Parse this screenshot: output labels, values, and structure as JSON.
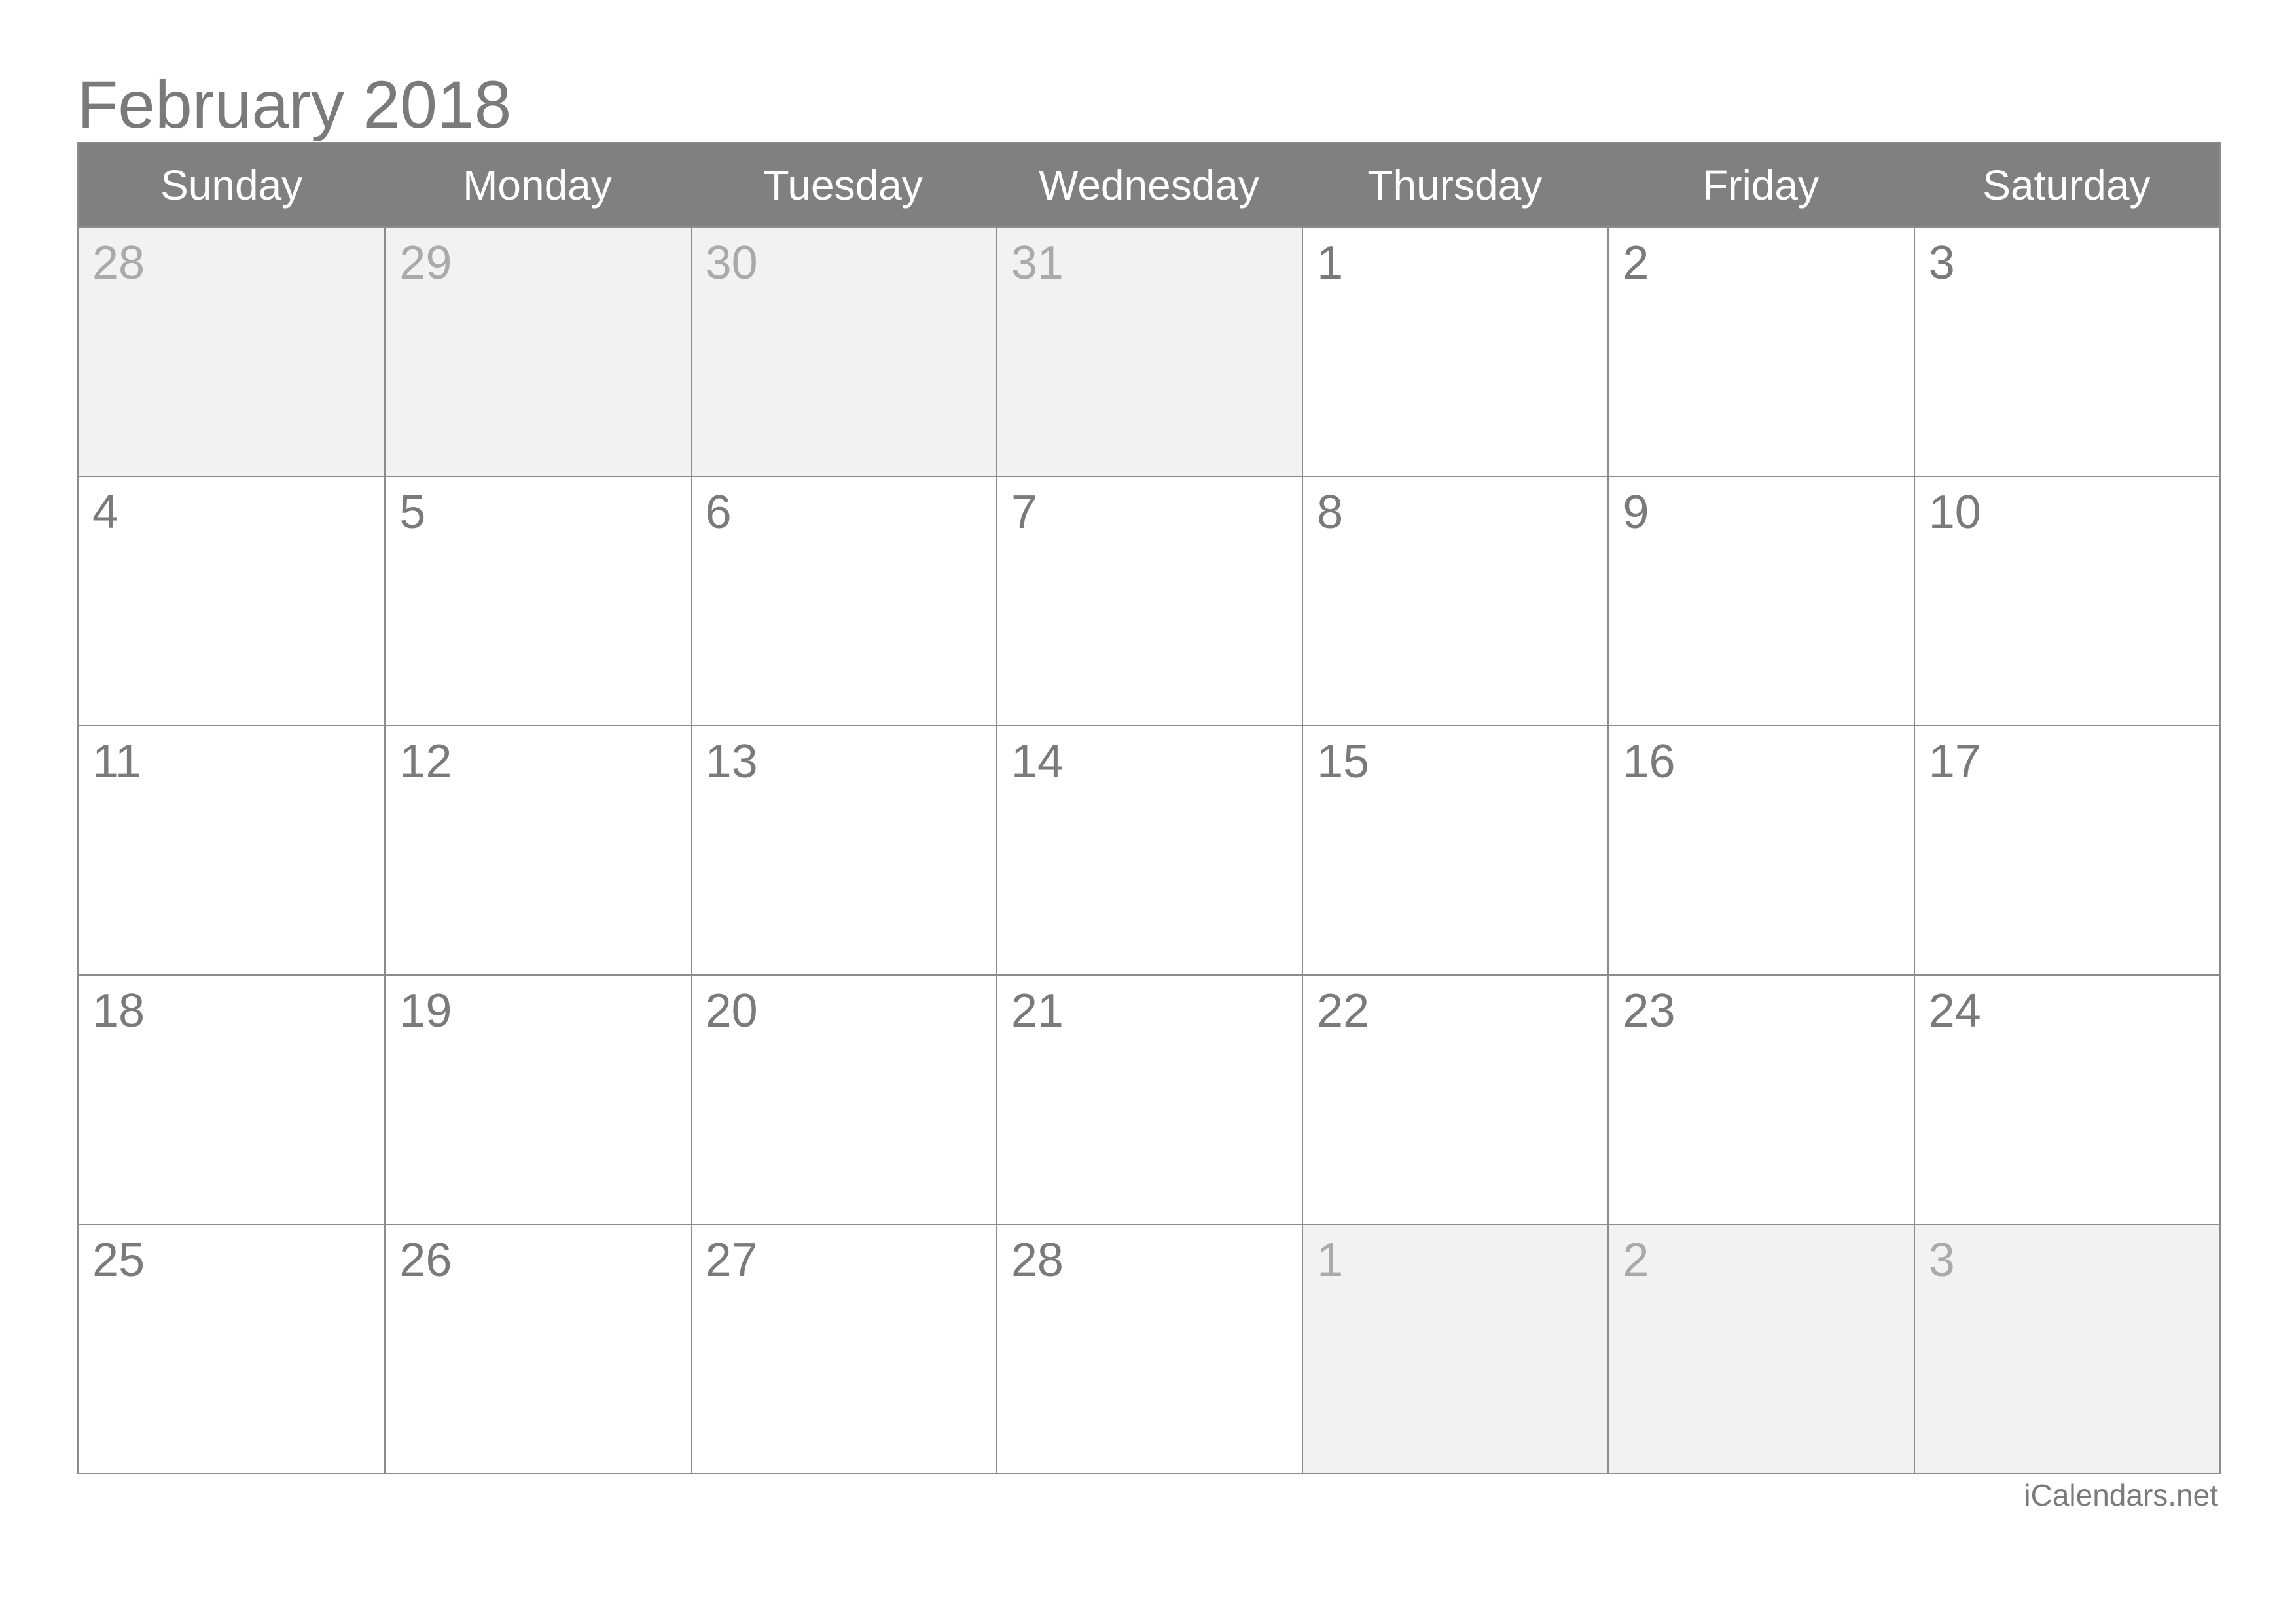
{
  "title": "February 2018",
  "weekdays": [
    "Sunday",
    "Monday",
    "Tuesday",
    "Wednesday",
    "Thursday",
    "Friday",
    "Saturday"
  ],
  "weeks": [
    [
      {
        "day": "28",
        "other": true
      },
      {
        "day": "29",
        "other": true
      },
      {
        "day": "30",
        "other": true
      },
      {
        "day": "31",
        "other": true
      },
      {
        "day": "1",
        "other": false
      },
      {
        "day": "2",
        "other": false
      },
      {
        "day": "3",
        "other": false
      }
    ],
    [
      {
        "day": "4",
        "other": false
      },
      {
        "day": "5",
        "other": false
      },
      {
        "day": "6",
        "other": false
      },
      {
        "day": "7",
        "other": false
      },
      {
        "day": "8",
        "other": false
      },
      {
        "day": "9",
        "other": false
      },
      {
        "day": "10",
        "other": false
      }
    ],
    [
      {
        "day": "11",
        "other": false
      },
      {
        "day": "12",
        "other": false
      },
      {
        "day": "13",
        "other": false
      },
      {
        "day": "14",
        "other": false
      },
      {
        "day": "15",
        "other": false
      },
      {
        "day": "16",
        "other": false
      },
      {
        "day": "17",
        "other": false
      }
    ],
    [
      {
        "day": "18",
        "other": false
      },
      {
        "day": "19",
        "other": false
      },
      {
        "day": "20",
        "other": false
      },
      {
        "day": "21",
        "other": false
      },
      {
        "day": "22",
        "other": false
      },
      {
        "day": "23",
        "other": false
      },
      {
        "day": "24",
        "other": false
      }
    ],
    [
      {
        "day": "25",
        "other": false
      },
      {
        "day": "26",
        "other": false
      },
      {
        "day": "27",
        "other": false
      },
      {
        "day": "28",
        "other": false
      },
      {
        "day": "1",
        "other": true
      },
      {
        "day": "2",
        "other": true
      },
      {
        "day": "3",
        "other": true
      }
    ]
  ],
  "footer": "iCalendars.net",
  "colors": {
    "header_bg": "#808080",
    "text": "#7a7a7a",
    "other_month_bg": "#f2f2f2",
    "other_month_text": "#aaaaaa",
    "border": "#8c8c8c"
  }
}
